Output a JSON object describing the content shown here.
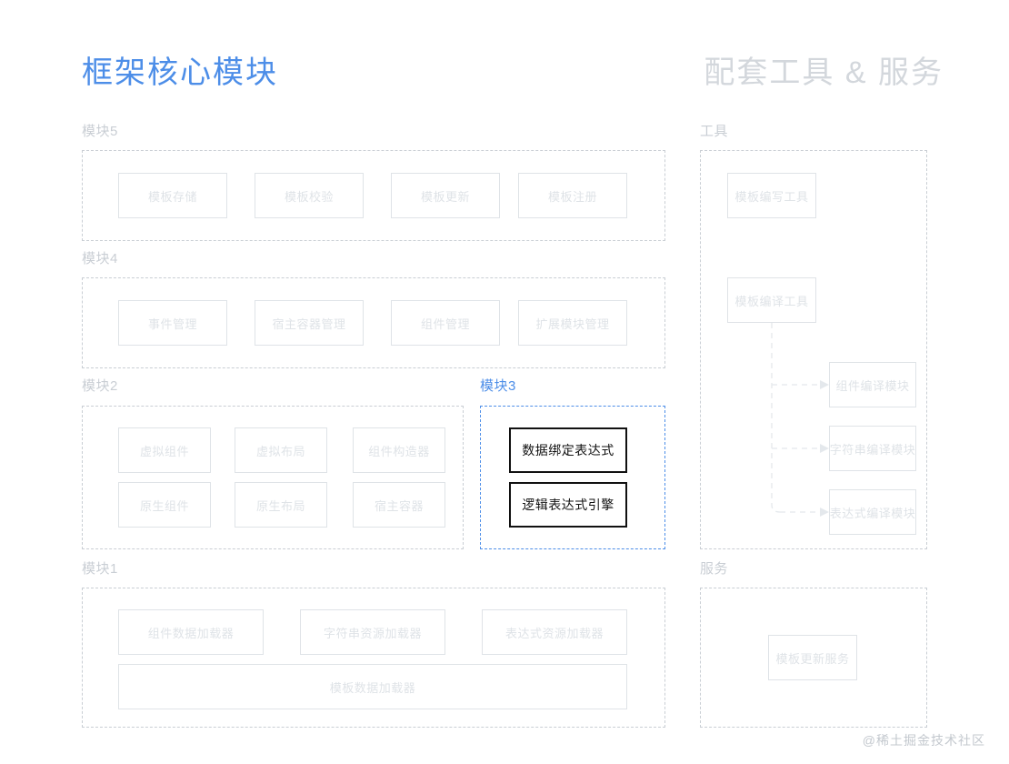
{
  "headers": {
    "left": "框架核心模块",
    "right": "配套工具 & 服务"
  },
  "colors": {
    "accent": "#4d8ee8",
    "muted_text": "#dfe3e7",
    "label_text": "#c9ced4",
    "strong_border": "#111111",
    "box_border": "#dfe3e7",
    "group_border": "#c9ced4"
  },
  "left_column": {
    "groups": [
      {
        "label": "模块5",
        "highlighted": false,
        "rows": [
          [
            "模板存储",
            "模板校验",
            "模板更新",
            "模板注册"
          ]
        ]
      },
      {
        "label": "模块4",
        "highlighted": false,
        "rows": [
          [
            "事件管理",
            "宿主容器管理",
            "组件管理",
            "扩展模块管理"
          ]
        ]
      },
      {
        "label": "模块2",
        "highlighted": false,
        "rows": [
          [
            "虚拟组件",
            "虚拟布局",
            "组件构造器"
          ],
          [
            "原生组件",
            "原生布局",
            "宿主容器"
          ]
        ]
      },
      {
        "label": "模块3",
        "highlighted": true,
        "rows": [
          [
            "数据绑定表达式"
          ],
          [
            "逻辑表达式引擎"
          ]
        ]
      },
      {
        "label": "模块1",
        "highlighted": false,
        "rows": [
          [
            "组件数据加载器",
            "字符串资源加载器",
            "表达式资源加载器"
          ],
          [
            "模板数据加载器"
          ]
        ]
      }
    ]
  },
  "right_column": {
    "groups": [
      {
        "label": "工具",
        "nodes": [
          "模板编写工具",
          "模板编译工具",
          "组件编译模块",
          "字符串编译模块",
          "表达式编译模块"
        ]
      },
      {
        "label": "服务",
        "nodes": [
          "模板更新服务"
        ]
      }
    ]
  },
  "watermark": "@稀土掘金技术社区"
}
